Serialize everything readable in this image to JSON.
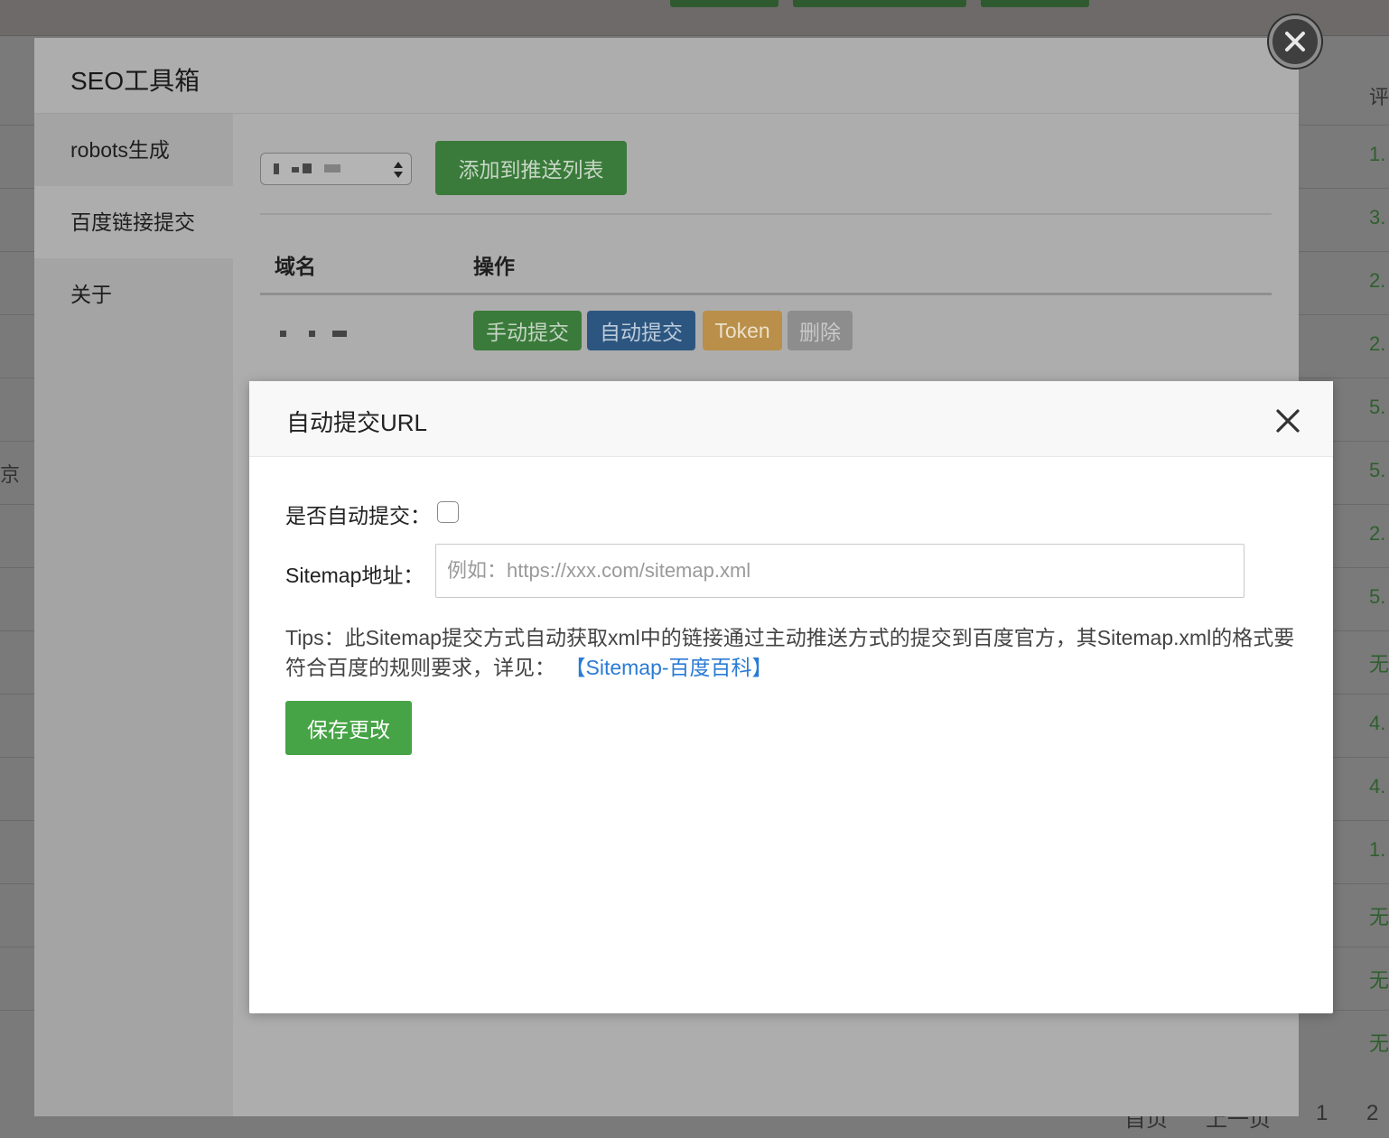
{
  "background": {
    "right_column_header": "评",
    "right_column_values": [
      "1.",
      "3.",
      "2.",
      "2.",
      "5.",
      "5.",
      "2.",
      "5.",
      "无",
      "4.",
      "4.",
      "1.",
      "无",
      "无",
      "无"
    ],
    "left_fragment": "京",
    "pager": [
      "首页",
      "上一页",
      "1",
      "2"
    ]
  },
  "seo_toolbox": {
    "title": "SEO工具箱",
    "sidebar": [
      {
        "label": "robots生成"
      },
      {
        "label": "百度链接提交"
      },
      {
        "label": "关于"
      }
    ],
    "add_button": "添加到推送列表",
    "table": {
      "headers": [
        "域名",
        "操作"
      ],
      "actions": {
        "manual": "手动提交",
        "auto": "自动提交",
        "token": "Token",
        "delete": "删除"
      }
    }
  },
  "dialog": {
    "title": "自动提交URL",
    "auto_submit_label": "是否自动提交：",
    "sitemap_label": "Sitemap地址：",
    "sitemap_value": "",
    "sitemap_placeholder": "例如：https://xxx.com/sitemap.xml",
    "tips_text": "Tips：此Sitemap提交方式自动获取xml中的链接通过主动推送方式的提交到百度官方，其Sitemap.xml的格式要符合百度的规则要求，详见：",
    "tips_link": "【Sitemap-百度百科】",
    "save_button": "保存更改"
  },
  "colors": {
    "success": "#46a346",
    "primary": "#337ab7",
    "warning": "#f0ad4e",
    "link": "#2a7bd4"
  }
}
